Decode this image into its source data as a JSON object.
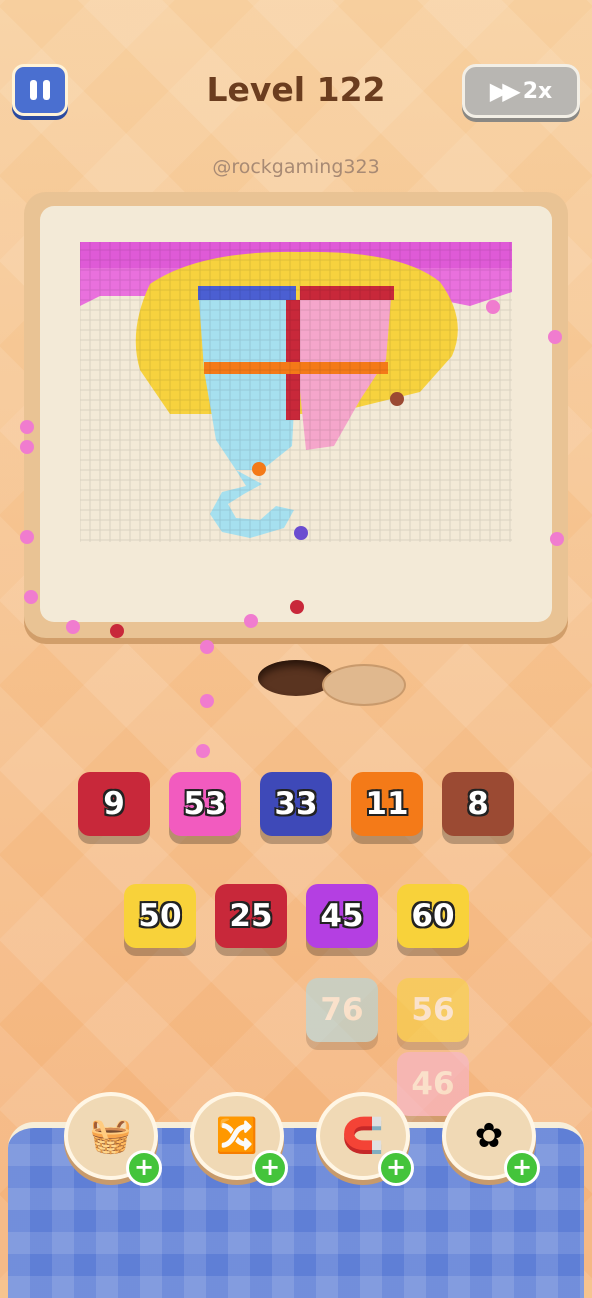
{
  "header": {
    "level_text": "Level 122",
    "speed_label": "2x"
  },
  "watermark": "@rockgaming323",
  "icons": {
    "pause": "pause-icon",
    "speed": "fast-forward-icon"
  },
  "queue_row1": [
    {
      "value": "9",
      "color": "#c8283a"
    },
    {
      "value": "53",
      "color": "#f25bbf"
    },
    {
      "value": "33",
      "color": "#3e49b8"
    },
    {
      "value": "11",
      "color": "#f47a18"
    },
    {
      "value": "8",
      "color": "#9b4a33"
    }
  ],
  "queue_row2": [
    {
      "value": "50",
      "color": "#f8d23a"
    },
    {
      "value": "25",
      "color": "#c8283a"
    },
    {
      "value": "45",
      "color": "#b43fe2"
    },
    {
      "value": "60",
      "color": "#f8d23a"
    }
  ],
  "queue_waiting": [
    {
      "value": "76",
      "color": "#a9dcea"
    },
    {
      "value": "56",
      "color": "#f8d23a"
    },
    {
      "value": "46",
      "color": "#f7b2d4"
    }
  ],
  "powerups": [
    {
      "name": "add-tray-icon",
      "glyph": "🧺"
    },
    {
      "name": "shuffle-icon",
      "glyph": "🔀"
    },
    {
      "name": "magnet-icon",
      "glyph": "🧲"
    },
    {
      "name": "flower-icon",
      "glyph": "✿"
    }
  ]
}
